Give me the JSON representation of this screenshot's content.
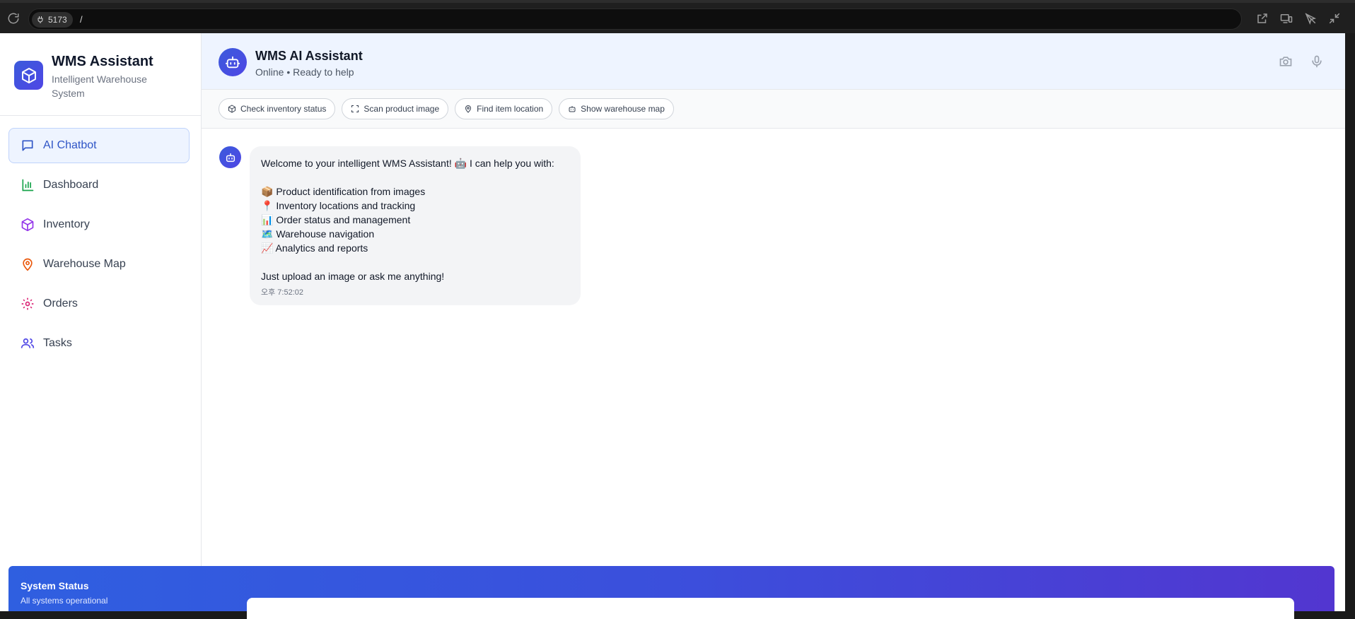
{
  "browser": {
    "port_label": "5173",
    "path": "/"
  },
  "brand": {
    "title": "WMS Assistant",
    "subtitle": "Intelligent Warehouse System"
  },
  "nav": {
    "items": [
      {
        "label": "AI Chatbot",
        "icon": "message-square-icon",
        "active": true
      },
      {
        "label": "Dashboard",
        "icon": "bar-chart-icon"
      },
      {
        "label": "Inventory",
        "icon": "package-icon"
      },
      {
        "label": "Warehouse Map",
        "icon": "map-pin-icon"
      },
      {
        "label": "Orders",
        "icon": "gear-icon"
      },
      {
        "label": "Tasks",
        "icon": "users-icon"
      }
    ]
  },
  "chat": {
    "title": "WMS AI Assistant",
    "status": "Online • Ready to help"
  },
  "quick_actions": [
    {
      "label": "Check inventory status",
      "icon": "package-icon"
    },
    {
      "label": "Scan product image",
      "icon": "scan-icon"
    },
    {
      "label": "Find item location",
      "icon": "map-pin-icon"
    },
    {
      "label": "Show warehouse map",
      "icon": "bot-icon"
    }
  ],
  "message": {
    "intro": "Welcome to your intelligent WMS Assistant! 🤖 I can help you with:",
    "items": [
      "📦 Product identification from images",
      "📍 Inventory locations and tracking",
      "📊 Order status and management",
      "🗺️ Warehouse navigation",
      "📈 Analytics and reports"
    ],
    "outro": "Just upload an image or ask me anything!",
    "time": "오후 7:52:02"
  },
  "system_status": {
    "title": "System Status",
    "subtitle": "All systems operational"
  },
  "colors": {
    "accent": "#3b5bdb",
    "nav_active_bg": "#eef4ff",
    "header_bg": "#eef4ff"
  }
}
